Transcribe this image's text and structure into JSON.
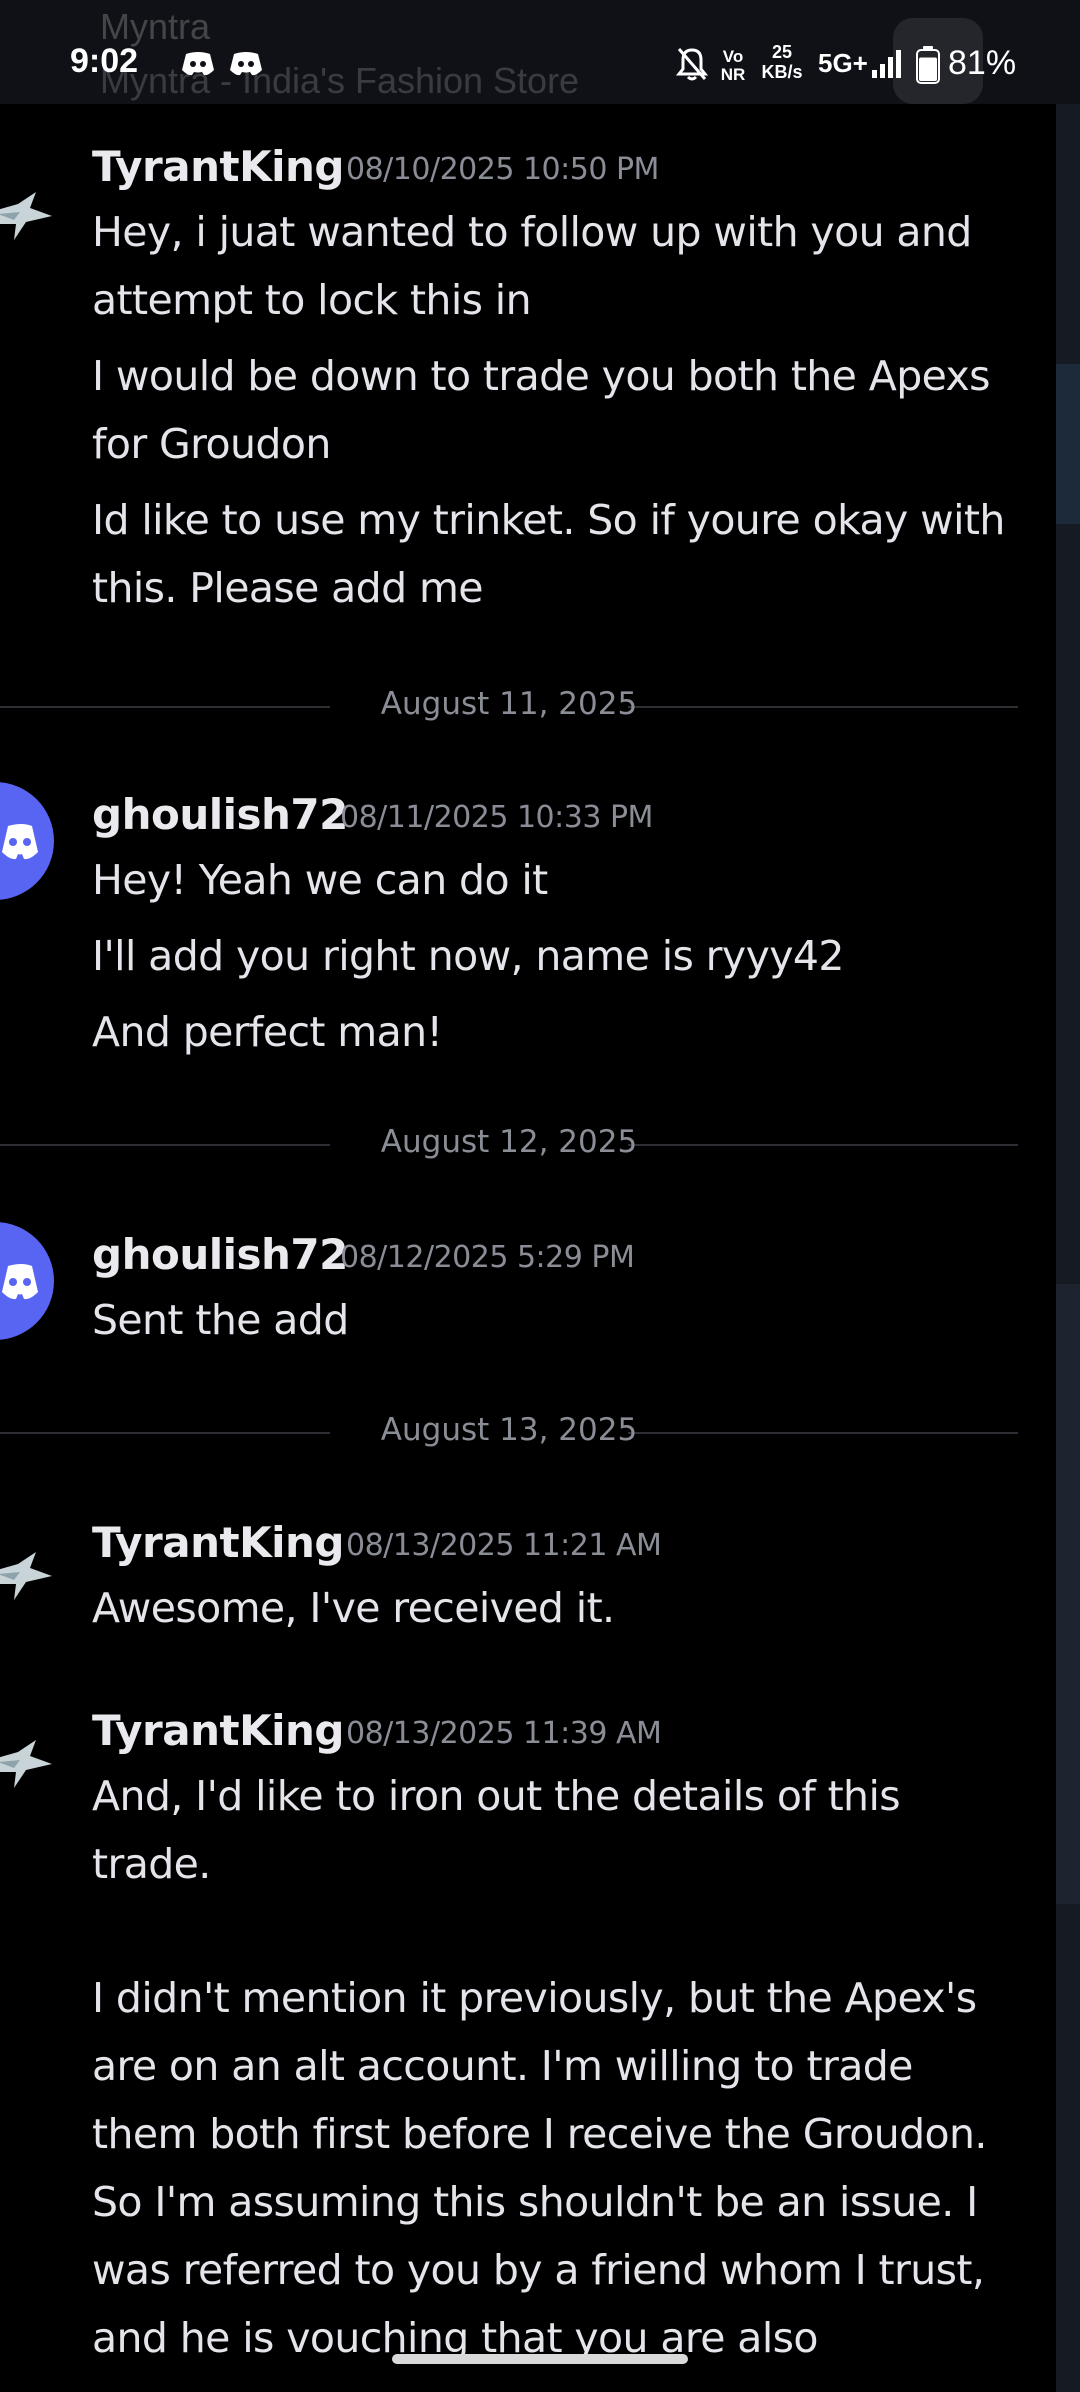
{
  "status_bar": {
    "time": "9:02",
    "bg_app_name": "Myntra",
    "bg_app_subtitle": "Myntra - India's Fashion Store",
    "volte": "Vo NR",
    "net_speed_value": "25",
    "net_speed_unit": "KB/s",
    "network_type": "5G+",
    "battery_percent": "81%",
    "battery_level": 0.81
  },
  "dividers": [
    {
      "label": "August 11, 2025"
    },
    {
      "label": "August 12, 2025"
    },
    {
      "label": "August 13, 2025"
    }
  ],
  "messages": [
    {
      "author": "TyrantKing",
      "timestamp": "08/10/2025 10:50 PM",
      "lines": [
        "Hey, i juat wanted to follow up with you and",
        "attempt to lock this in",
        "I would be down to trade you both the Apexs",
        "for Groudon",
        "Id like to use my trinket. So if youre okay with",
        "this. Please add me"
      ]
    },
    {
      "author": "ghoulish72",
      "timestamp": "08/11/2025 10:33 PM",
      "lines": [
        "Hey! Yeah we can do it",
        "I'll add you right now, name is ryyy42",
        "And perfect man!"
      ]
    },
    {
      "author": "ghoulish72",
      "timestamp": "08/12/2025 5:29 PM",
      "lines": [
        "Sent the add"
      ]
    },
    {
      "author": "TyrantKing",
      "timestamp": "08/13/2025 11:21 AM",
      "lines": [
        "Awesome, I've received it."
      ]
    },
    {
      "author": "TyrantKing",
      "timestamp": "08/13/2025 11:39 AM",
      "lines": [
        "And, I'd like to iron out the details of this",
        "trade.",
        "",
        "I didn't mention it previously, but the Apex's",
        "are on an alt account. I'm willing to trade",
        "them both first before I receive the Groudon.",
        "So I'm assuming this shouldn't be an issue. I",
        "was referred to you by a friend whom I trust,",
        "and he is vouching that you are also"
      ]
    }
  ],
  "colors": {
    "background": "#000000",
    "discord_blurple": "#5865f2",
    "username": "#e9e9ee",
    "timestamp": "#8a8d95"
  },
  "icons": [
    "discord-notification-icon",
    "mute-bell-icon",
    "signal-bars-icon",
    "battery-icon",
    "discord-avatar-icon",
    "dragon-avatar-icon"
  ]
}
